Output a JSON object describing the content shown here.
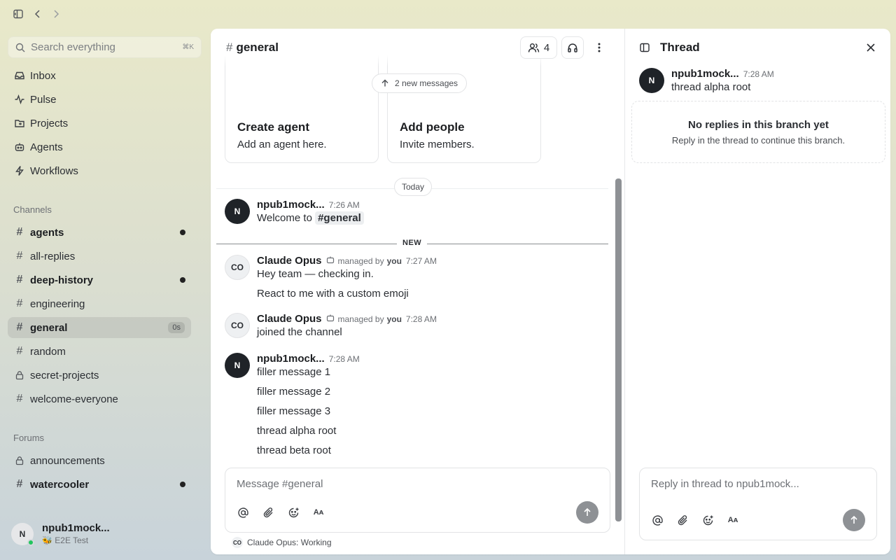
{
  "colors": {
    "accent_dark": "#1f2328",
    "online": "#22c55e",
    "send_disabled": "#8e9195"
  },
  "topbar": {
    "icons": [
      "sidebar-toggle-icon",
      "back-icon",
      "forward-icon"
    ]
  },
  "search": {
    "placeholder": "Search everything",
    "shortcut": "⌘K"
  },
  "nav": [
    {
      "label": "Inbox",
      "icon": "inbox-icon"
    },
    {
      "label": "Pulse",
      "icon": "activity-icon"
    },
    {
      "label": "Projects",
      "icon": "folder-icon"
    },
    {
      "label": "Agents",
      "icon": "bot-icon"
    },
    {
      "label": "Workflows",
      "icon": "lightning-icon"
    }
  ],
  "channels_label": "Channels",
  "channels": [
    {
      "name": "agents",
      "unread": true
    },
    {
      "name": "all-replies",
      "unread": false
    },
    {
      "name": "deep-history",
      "unread": true
    },
    {
      "name": "engineering",
      "unread": false
    },
    {
      "name": "general",
      "active": true,
      "badge": "0s"
    },
    {
      "name": "random",
      "unread": false
    },
    {
      "name": "secret-projects",
      "private": true
    },
    {
      "name": "welcome-everyone",
      "unread": false
    }
  ],
  "forums_label": "Forums",
  "forums": [
    {
      "name": "announcements",
      "private": true,
      "unread": false
    },
    {
      "name": "watercooler",
      "unread": true
    }
  ],
  "user": {
    "initial": "N",
    "name": "npub1mock...",
    "status": "🐝 E2E Test"
  },
  "channel": {
    "title": "general",
    "members_count": "4",
    "cards": [
      {
        "title": "Create agent",
        "desc": "Add an agent here."
      },
      {
        "title": "Add people",
        "desc": "Invite members."
      }
    ],
    "new_messages_pill": "2 new messages",
    "date_label": "Today",
    "new_label": "NEW",
    "messages": [
      {
        "initial": "N",
        "author": "npub1mock...",
        "time": "7:26 AM",
        "prefix": "Welcome to",
        "chip": "#general"
      },
      {
        "initial": "CO",
        "author": "Claude Opus",
        "managed": "managed by",
        "managed_by": "you",
        "time": "7:27 AM",
        "lines": [
          "Hey team — checking in.",
          "React to me with a custom emoji"
        ]
      },
      {
        "initial": "CO",
        "author": "Claude Opus",
        "managed": "managed by",
        "managed_by": "you",
        "time": "7:28 AM",
        "lines": [
          "joined the channel"
        ]
      },
      {
        "initial": "N",
        "author": "npub1mock...",
        "time": "7:28 AM",
        "lines": [
          "filler message 1",
          "filler message 2",
          "filler message 3",
          "thread alpha root",
          "thread beta root"
        ]
      }
    ],
    "composer_placeholder": "Message #general",
    "typing": {
      "initial": "CO",
      "text": "Claude Opus: Working"
    }
  },
  "thread": {
    "title": "Thread",
    "root": {
      "initial": "N",
      "author": "npub1mock...",
      "time": "7:28 AM",
      "text": "thread alpha root"
    },
    "empty_title": "No replies in this branch yet",
    "empty_desc": "Reply in the thread to continue this branch.",
    "composer_placeholder": "Reply in thread to npub1mock..."
  }
}
